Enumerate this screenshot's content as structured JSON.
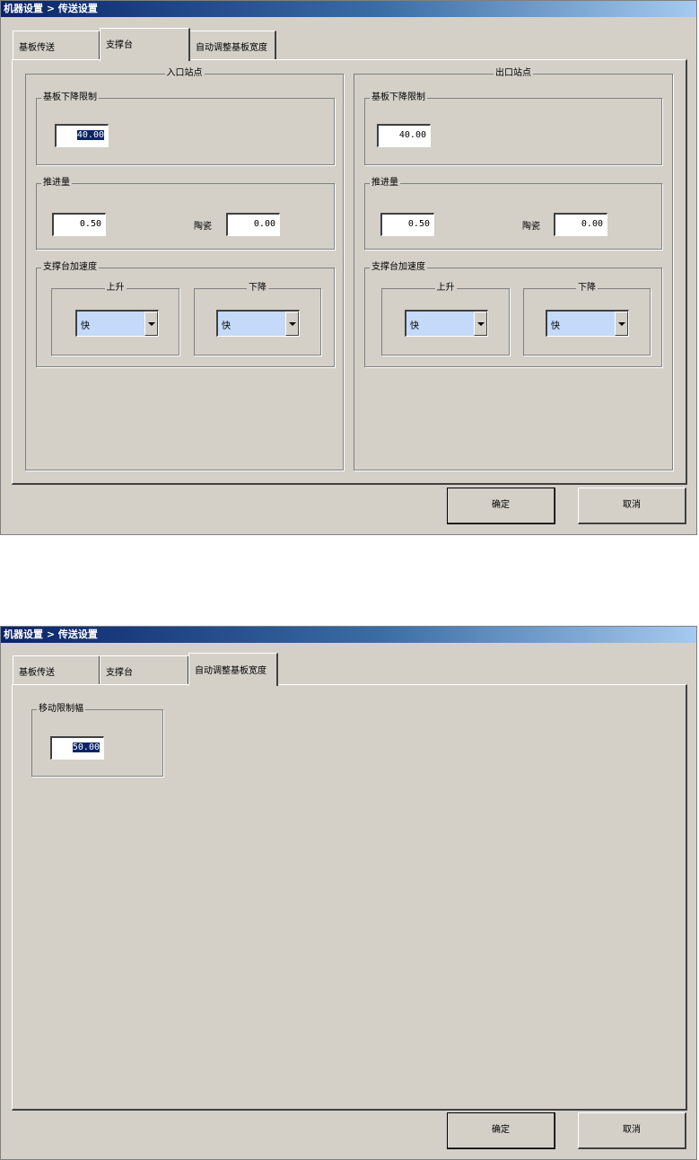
{
  "window_title": "机器设置 > 传送设置",
  "tabs": [
    "基板传送",
    "支撑台",
    "自动调整基板宽度"
  ],
  "buttons": {
    "ok": "确定",
    "cancel": "取消"
  },
  "support_tab": {
    "entry": {
      "title": "入口站点",
      "lower_limit": {
        "label": "基板下降限制",
        "value": "40.00"
      },
      "push": {
        "label": "推进量",
        "value": "0.50",
        "ceramic_label": "陶瓷",
        "ceramic_value": "0.00"
      },
      "speed": {
        "label": "支撑台加速度",
        "up_label": "上升",
        "up_value": "快",
        "down_label": "下降",
        "down_value": "快"
      }
    },
    "exit": {
      "title": "出口站点",
      "lower_limit": {
        "label": "基板下降限制",
        "value": "40.00"
      },
      "push": {
        "label": "推进量",
        "value": "0.50",
        "ceramic_label": "陶瓷",
        "ceramic_value": "0.00"
      },
      "speed": {
        "label": "支撑台加速度",
        "up_label": "上升",
        "up_value": "快",
        "down_label": "下降",
        "down_value": "快"
      }
    }
  },
  "width_tab": {
    "move_limit": {
      "label": "移动限制幅",
      "value": "50.00"
    }
  }
}
